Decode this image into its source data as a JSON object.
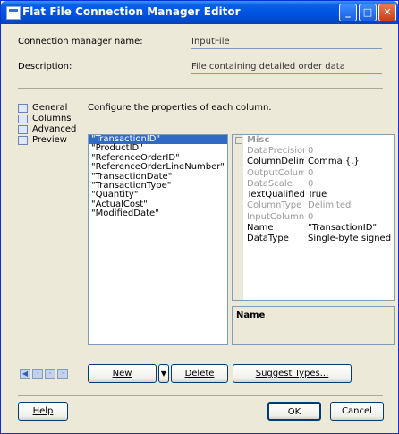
{
  "window": {
    "title": "Flat File Connection Manager Editor",
    "min_glyph": "_",
    "max_glyph": "□",
    "close_glyph": "✕"
  },
  "form": {
    "name_label": "Connection manager name:",
    "name_value": "InputFile",
    "description_label": "Description:",
    "description_value": "File containing detailed order data"
  },
  "nav": {
    "items": [
      {
        "label": "General"
      },
      {
        "label": "Columns"
      },
      {
        "label": "Advanced"
      },
      {
        "label": "Preview"
      }
    ]
  },
  "main": {
    "instruction": "Configure the properties of each column.",
    "columns": [
      "\"TransactionID\"",
      "\"ProductID\"",
      "\"ReferenceOrderID\"",
      "\"ReferenceOrderLineNumber\"",
      "\"TransactionDate\"",
      "\"TransactionType\"",
      "\"Quantity\"",
      "\"ActualCost\"",
      "\"ModifiedDate\""
    ],
    "selected_column_index": 0
  },
  "properties": {
    "category": "Misc",
    "rows": [
      {
        "name": "DataPrecision",
        "value": "0",
        "dim": true
      },
      {
        "name": "ColumnDelimiter",
        "value": "Comma {,}",
        "dim": false
      },
      {
        "name": "OutputColumnWidth",
        "value": "0",
        "dim": true
      },
      {
        "name": "DataScale",
        "value": "0",
        "dim": true
      },
      {
        "name": "TextQualified",
        "value": "True",
        "dim": false
      },
      {
        "name": "ColumnType",
        "value": "Delimited",
        "dim": true
      },
      {
        "name": "InputColumnWidth",
        "value": "0",
        "dim": true
      },
      {
        "name": "Name",
        "value": "\"TransactionID\"",
        "dim": false
      },
      {
        "name": "DataType",
        "value": "Single-byte signed",
        "dim": false
      }
    ],
    "description_title": "Name"
  },
  "buttons": {
    "new": "New",
    "split_arrow": "▼",
    "delete": "Delete",
    "suggest": "Suggest Types...",
    "help": "Help",
    "ok": "OK",
    "cancel": "Cancel"
  }
}
